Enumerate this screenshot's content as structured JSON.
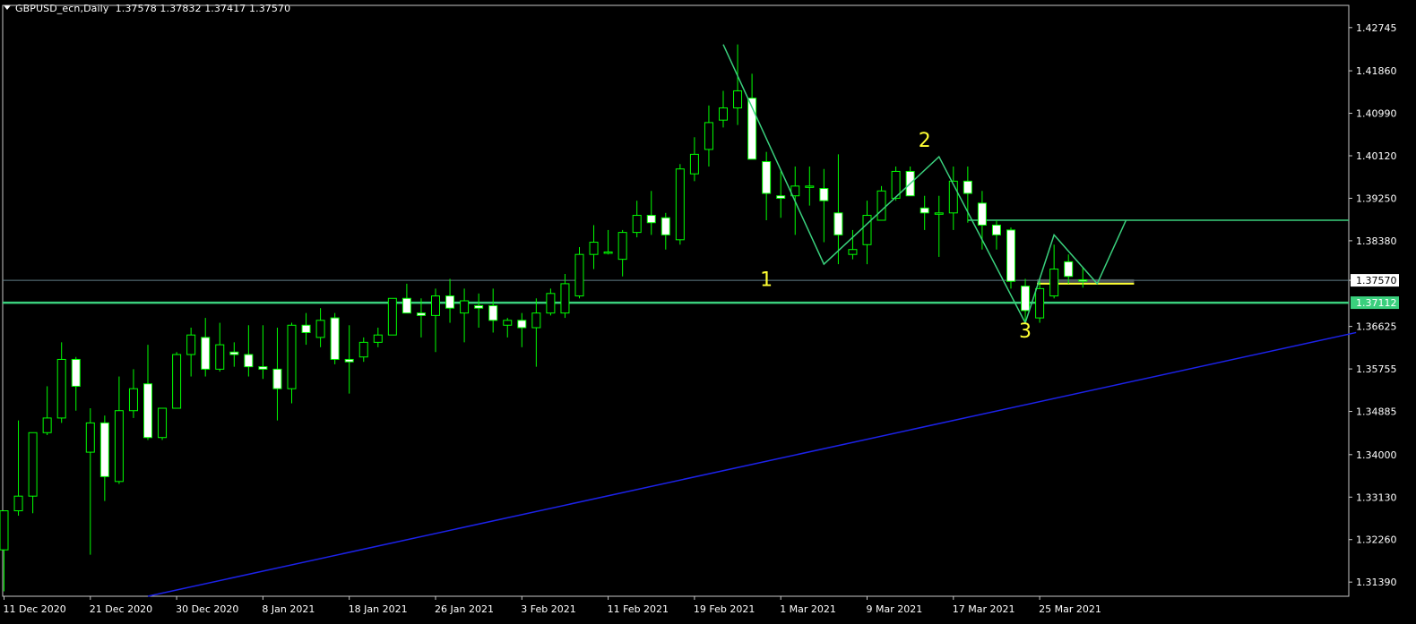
{
  "header": {
    "symbol": "GBPUSD_ecn,Daily",
    "ohlc": "1.37578 1.37832 1.37417 1.37570"
  },
  "colors": {
    "background": "#000000",
    "bull_candle": "#00ff00",
    "bear_candle": "#ffffff",
    "wave_line": "#3ad07d",
    "horizontal_level": "#3ad07d",
    "trend_line": "#1c22e8",
    "bid_line": "#5f7e86",
    "label_text": "#ffff33",
    "price_badge": "#3ad07d"
  },
  "chart_data": {
    "type": "candlestick",
    "y_axis_ticks": [
      "1.42745",
      "1.41860",
      "1.40990",
      "1.40120",
      "1.39250",
      "1.38380",
      "1.37570",
      "1.36625",
      "1.35755",
      "1.34885",
      "1.34000",
      "1.33130",
      "1.32260",
      "1.31390"
    ],
    "ylim": [
      1.311,
      1.432
    ],
    "x_axis_labels": [
      "11 Dec 2020",
      "21 Dec 2020",
      "30 Dec 2020",
      "8 Jan 2021",
      "18 Jan 2021",
      "26 Jan 2021",
      "3 Feb 2021",
      "11 Feb 2021",
      "19 Feb 2021",
      "1 Mar 2021",
      "9 Mar 2021",
      "17 Mar 2021",
      "25 Mar 2021"
    ],
    "x_axis_label_bars": [
      0,
      6,
      12,
      18,
      24,
      30,
      36,
      42,
      48,
      54,
      60,
      66,
      72
    ],
    "candles": [
      {
        "o": 1.3205,
        "h": 1.3215,
        "l": 1.312,
        "c": 1.3285
      },
      {
        "o": 1.3285,
        "h": 1.347,
        "l": 1.3275,
        "c": 1.3315
      },
      {
        "o": 1.3315,
        "h": 1.3365,
        "l": 1.328,
        "c": 1.3445
      },
      {
        "o": 1.3445,
        "h": 1.354,
        "l": 1.344,
        "c": 1.3475
      },
      {
        "o": 1.3475,
        "h": 1.363,
        "l": 1.3465,
        "c": 1.3595
      },
      {
        "o": 1.3595,
        "h": 1.36,
        "l": 1.349,
        "c": 1.354
      },
      {
        "o": 1.3405,
        "h": 1.3495,
        "l": 1.3195,
        "c": 1.3465
      },
      {
        "o": 1.3465,
        "h": 1.348,
        "l": 1.3305,
        "c": 1.3355
      },
      {
        "o": 1.3345,
        "h": 1.356,
        "l": 1.334,
        "c": 1.349
      },
      {
        "o": 1.349,
        "h": 1.3575,
        "l": 1.3475,
        "c": 1.3535
      },
      {
        "o": 1.3545,
        "h": 1.3625,
        "l": 1.343,
        "c": 1.3435
      },
      {
        "o": 1.3435,
        "h": 1.3495,
        "l": 1.343,
        "c": 1.3495
      },
      {
        "o": 1.3495,
        "h": 1.361,
        "l": 1.3495,
        "c": 1.3605
      },
      {
        "o": 1.3605,
        "h": 1.366,
        "l": 1.356,
        "c": 1.3645
      },
      {
        "o": 1.364,
        "h": 1.368,
        "l": 1.356,
        "c": 1.3575
      },
      {
        "o": 1.3575,
        "h": 1.367,
        "l": 1.357,
        "c": 1.3625
      },
      {
        "o": 1.361,
        "h": 1.363,
        "l": 1.358,
        "c": 1.3605
      },
      {
        "o": 1.3605,
        "h": 1.3665,
        "l": 1.356,
        "c": 1.358
      },
      {
        "o": 1.358,
        "h": 1.3665,
        "l": 1.3555,
        "c": 1.3575
      },
      {
        "o": 1.3575,
        "h": 1.366,
        "l": 1.347,
        "c": 1.3535
      },
      {
        "o": 1.3535,
        "h": 1.367,
        "l": 1.3505,
        "c": 1.3665
      },
      {
        "o": 1.3665,
        "h": 1.369,
        "l": 1.3625,
        "c": 1.365
      },
      {
        "o": 1.364,
        "h": 1.37,
        "l": 1.362,
        "c": 1.3675
      },
      {
        "o": 1.368,
        "h": 1.369,
        "l": 1.3585,
        "c": 1.3595
      },
      {
        "o": 1.3595,
        "h": 1.3665,
        "l": 1.3525,
        "c": 1.359
      },
      {
        "o": 1.36,
        "h": 1.364,
        "l": 1.359,
        "c": 1.363
      },
      {
        "o": 1.363,
        "h": 1.366,
        "l": 1.362,
        "c": 1.3645
      },
      {
        "o": 1.3645,
        "h": 1.372,
        "l": 1.3645,
        "c": 1.372
      },
      {
        "o": 1.372,
        "h": 1.375,
        "l": 1.37,
        "c": 1.369
      },
      {
        "o": 1.369,
        "h": 1.372,
        "l": 1.364,
        "c": 1.3685
      },
      {
        "o": 1.3685,
        "h": 1.374,
        "l": 1.361,
        "c": 1.3725
      },
      {
        "o": 1.3725,
        "h": 1.376,
        "l": 1.367,
        "c": 1.37
      },
      {
        "o": 1.369,
        "h": 1.374,
        "l": 1.363,
        "c": 1.3715
      },
      {
        "o": 1.3705,
        "h": 1.373,
        "l": 1.366,
        "c": 1.37
      },
      {
        "o": 1.3705,
        "h": 1.374,
        "l": 1.365,
        "c": 1.3675
      },
      {
        "o": 1.3665,
        "h": 1.368,
        "l": 1.364,
        "c": 1.3675
      },
      {
        "o": 1.3675,
        "h": 1.369,
        "l": 1.362,
        "c": 1.366
      },
      {
        "o": 1.366,
        "h": 1.372,
        "l": 1.358,
        "c": 1.369
      },
      {
        "o": 1.369,
        "h": 1.374,
        "l": 1.3685,
        "c": 1.373
      },
      {
        "o": 1.369,
        "h": 1.377,
        "l": 1.368,
        "c": 1.375
      },
      {
        "o": 1.3725,
        "h": 1.3825,
        "l": 1.372,
        "c": 1.381
      },
      {
        "o": 1.381,
        "h": 1.387,
        "l": 1.378,
        "c": 1.3835
      },
      {
        "o": 1.3815,
        "h": 1.386,
        "l": 1.381,
        "c": 1.3815
      },
      {
        "o": 1.38,
        "h": 1.386,
        "l": 1.3765,
        "c": 1.3855
      },
      {
        "o": 1.3855,
        "h": 1.392,
        "l": 1.3845,
        "c": 1.389
      },
      {
        "o": 1.389,
        "h": 1.394,
        "l": 1.385,
        "c": 1.3875
      },
      {
        "o": 1.3885,
        "h": 1.3895,
        "l": 1.382,
        "c": 1.385
      },
      {
        "o": 1.384,
        "h": 1.3995,
        "l": 1.383,
        "c": 1.3985
      },
      {
        "o": 1.3975,
        "h": 1.405,
        "l": 1.396,
        "c": 1.4015
      },
      {
        "o": 1.4025,
        "h": 1.4115,
        "l": 1.399,
        "c": 1.408
      },
      {
        "o": 1.4085,
        "h": 1.4145,
        "l": 1.407,
        "c": 1.411
      },
      {
        "o": 1.411,
        "h": 1.424,
        "l": 1.4075,
        "c": 1.4145
      },
      {
        "o": 1.413,
        "h": 1.418,
        "l": 1.4005,
        "c": 1.4005
      },
      {
        "o": 1.4,
        "h": 1.402,
        "l": 1.388,
        "c": 1.3935
      },
      {
        "o": 1.393,
        "h": 1.398,
        "l": 1.3885,
        "c": 1.3925
      },
      {
        "o": 1.393,
        "h": 1.399,
        "l": 1.385,
        "c": 1.395
      },
      {
        "o": 1.395,
        "h": 1.399,
        "l": 1.391,
        "c": 1.395
      },
      {
        "o": 1.3945,
        "h": 1.3985,
        "l": 1.3835,
        "c": 1.392
      },
      {
        "o": 1.3895,
        "h": 1.4015,
        "l": 1.379,
        "c": 1.385
      },
      {
        "o": 1.381,
        "h": 1.386,
        "l": 1.38,
        "c": 1.382
      },
      {
        "o": 1.383,
        "h": 1.392,
        "l": 1.379,
        "c": 1.389
      },
      {
        "o": 1.388,
        "h": 1.395,
        "l": 1.388,
        "c": 1.394
      },
      {
        "o": 1.3925,
        "h": 1.399,
        "l": 1.392,
        "c": 1.398
      },
      {
        "o": 1.398,
        "h": 1.399,
        "l": 1.393,
        "c": 1.393
      },
      {
        "o": 1.3905,
        "h": 1.393,
        "l": 1.386,
        "c": 1.3895
      },
      {
        "o": 1.3895,
        "h": 1.393,
        "l": 1.3805,
        "c": 1.3895
      },
      {
        "o": 1.3895,
        "h": 1.399,
        "l": 1.386,
        "c": 1.396
      },
      {
        "o": 1.396,
        "h": 1.399,
        "l": 1.3875,
        "c": 1.3935
      },
      {
        "o": 1.3915,
        "h": 1.394,
        "l": 1.382,
        "c": 1.387
      },
      {
        "o": 1.387,
        "h": 1.388,
        "l": 1.382,
        "c": 1.385
      },
      {
        "o": 1.386,
        "h": 1.3865,
        "l": 1.374,
        "c": 1.3755
      },
      {
        "o": 1.3745,
        "h": 1.376,
        "l": 1.367,
        "c": 1.3695
      },
      {
        "o": 1.368,
        "h": 1.3755,
        "l": 1.367,
        "c": 1.374
      },
      {
        "o": 1.3725,
        "h": 1.383,
        "l": 1.372,
        "c": 1.378
      },
      {
        "o": 1.3795,
        "h": 1.381,
        "l": 1.375,
        "c": 1.3765
      },
      {
        "o": 1.3758,
        "h": 1.3783,
        "l": 1.3742,
        "c": 1.3757
      }
    ],
    "wave_labels": [
      {
        "text": "1",
        "bar": 53,
        "price": 1.3745
      },
      {
        "text": "2",
        "bar": 64,
        "price": 1.403
      },
      {
        "text": "3",
        "bar": 71,
        "price": 1.364
      }
    ],
    "wave_path": [
      {
        "bar": 50,
        "price": 1.424
      },
      {
        "bar": 57,
        "price": 1.379
      },
      {
        "bar": 65,
        "price": 1.401
      },
      {
        "bar": 71,
        "price": 1.367
      },
      {
        "bar": 73,
        "price": 1.385
      },
      {
        "bar": 76,
        "price": 1.375
      },
      {
        "bar": 78,
        "price": 1.388
      }
    ],
    "resistance_level": {
      "price": 1.388,
      "from_bar": 67,
      "to_bar": 94
    },
    "support_level": {
      "price": 1.37112
    },
    "yellow_segment": {
      "price": 1.375,
      "from_bar": 72,
      "to_bar": 78
    },
    "bid_level": {
      "price": 1.3757
    },
    "trend_line": {
      "from": {
        "bar": 10,
        "price": 1.311
      },
      "to": {
        "bar": 94,
        "price": 1.365
      }
    },
    "price_labels": {
      "bid": "1.37570",
      "support": "1.37112"
    }
  }
}
